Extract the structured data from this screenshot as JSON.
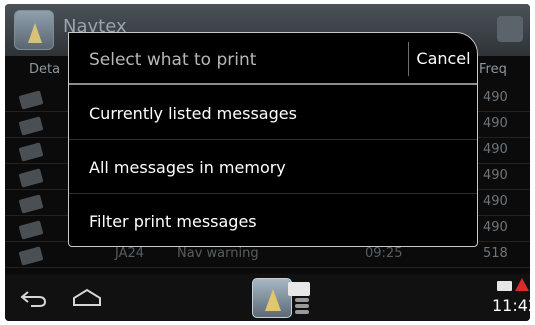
{
  "background_app": {
    "title": "Navtex",
    "columns": {
      "detail": "Deta",
      "freq": "Freq"
    },
    "rows": [
      {
        "freq": "490",
        "t1": "",
        "t2": "",
        "t3": ""
      },
      {
        "freq": "490",
        "t1": "",
        "t2": "",
        "t3": ""
      },
      {
        "freq": "490",
        "t1": "",
        "t2": "",
        "t3": ""
      },
      {
        "freq": "490",
        "t1": "",
        "t2": "",
        "t3": ""
      },
      {
        "freq": "490",
        "t1": "",
        "t2": "",
        "t3": ""
      },
      {
        "freq": "490",
        "t1": "",
        "t2": "",
        "t3": ""
      },
      {
        "freq": "518",
        "t1": "JA24",
        "t2": "Nav warning",
        "t3": "09:25"
      }
    ]
  },
  "dialog": {
    "title": "Select what to print",
    "cancel_label": "Cancel",
    "items": [
      {
        "label": "Currently listed messages"
      },
      {
        "label": "All messages in memory"
      },
      {
        "label": "Filter print messages"
      }
    ]
  },
  "system_bar": {
    "time": "11:42",
    "icons": [
      "back-icon",
      "home-icon",
      "navtex-app-icon",
      "envelope-icon",
      "warning-icon"
    ]
  },
  "colors": {
    "dialog_bg": "#000000",
    "dialog_border": "#c9c9c9",
    "title_text": "#b8b8b8",
    "item_text": "#ffffff",
    "warning": "#d92b2b"
  }
}
